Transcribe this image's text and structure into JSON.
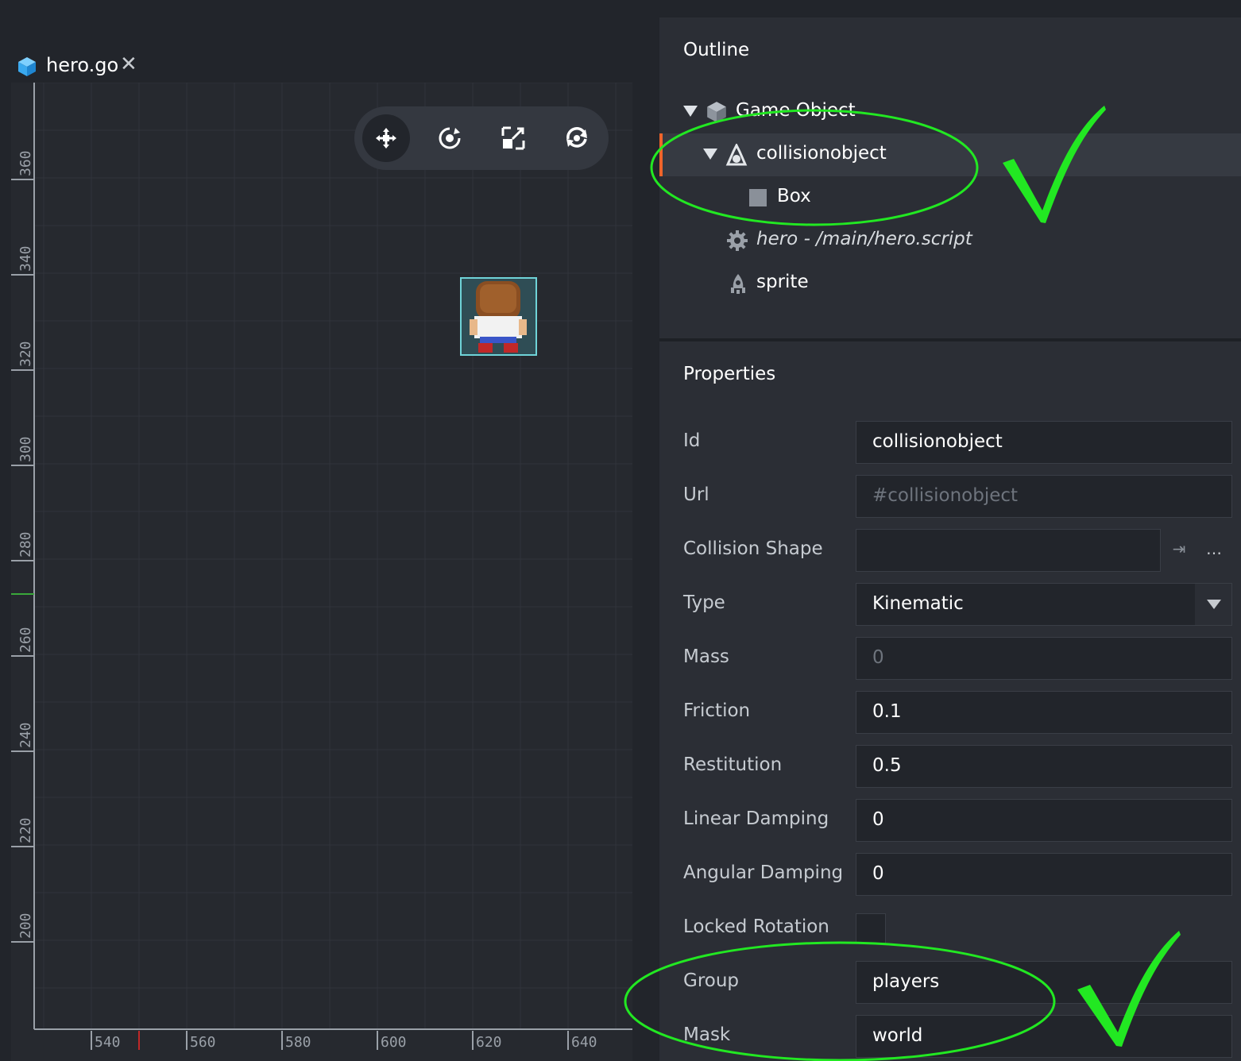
{
  "tab": {
    "title": "hero.go",
    "close_glyph": "✕",
    "icon": "cube-icon",
    "accent": "#f0642a"
  },
  "viewport": {
    "toolbar": [
      {
        "name": "move-tool",
        "icon": "move-icon",
        "active": true
      },
      {
        "name": "rotate-tool",
        "icon": "rotate-icon",
        "active": false
      },
      {
        "name": "scale-tool",
        "icon": "scale-icon",
        "active": false
      },
      {
        "name": "reset-tool",
        "icon": "reset-camera-icon",
        "active": false
      }
    ],
    "x_ticks": [
      "540",
      "560",
      "580",
      "600",
      "620",
      "640"
    ],
    "y_ticks": [
      "360",
      "340",
      "320",
      "300",
      "280",
      "260",
      "240",
      "220",
      "200"
    ]
  },
  "outline": {
    "title": "Outline",
    "items": [
      {
        "label": "Game Object",
        "icon": "cube-icon"
      },
      {
        "label": "collisionobject",
        "icon": "collision-object-icon"
      },
      {
        "label": "Box",
        "icon": "box-shape-icon"
      },
      {
        "label": "hero - /main/hero.script",
        "icon": "gear-icon"
      },
      {
        "label": "sprite",
        "icon": "sprite-icon"
      }
    ]
  },
  "properties": {
    "title": "Properties",
    "id": {
      "label": "Id",
      "value": "collisionobject"
    },
    "url": {
      "label": "Url",
      "value": "#collisionobject"
    },
    "collision_shape": {
      "label": "Collision Shape",
      "value": "",
      "goto_glyph": "⇥",
      "browse_glyph": "…"
    },
    "type": {
      "label": "Type",
      "value": "Kinematic"
    },
    "mass": {
      "label": "Mass",
      "value": "0"
    },
    "friction": {
      "label": "Friction",
      "value": "0.1"
    },
    "restitution": {
      "label": "Restitution",
      "value": "0.5"
    },
    "linear_damping": {
      "label": "Linear Damping",
      "value": "0"
    },
    "angular_damping": {
      "label": "Angular Damping",
      "value": "0"
    },
    "locked_rotation": {
      "label": "Locked Rotation",
      "checked": false
    },
    "group": {
      "label": "Group",
      "value": "players"
    },
    "mask": {
      "label": "Mask",
      "value": "world"
    }
  },
  "colors": {
    "annotation_green": "#22e822",
    "selection_accent": "#f0642a"
  }
}
